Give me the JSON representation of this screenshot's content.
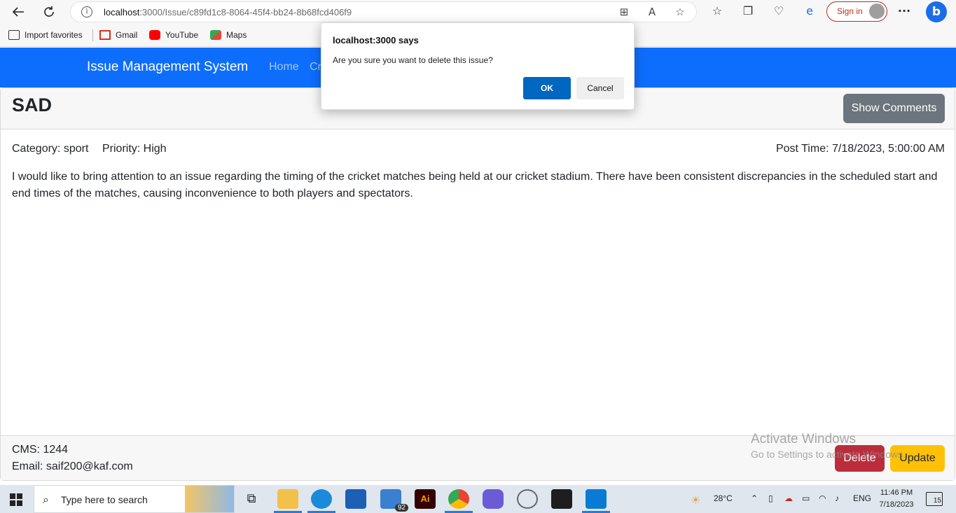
{
  "browser": {
    "url_host": "localhost",
    "url_rest": ":3000/Issue/c89fd1c8-8064-45f4-bb24-8b68fcd406f9",
    "signin_label": "Sign in",
    "bookmarks": [
      "Import favorites",
      "Gmail",
      "YouTube",
      "Maps"
    ]
  },
  "navbar": {
    "brand": "Issue Management System",
    "links": [
      "Home",
      "Cr"
    ]
  },
  "issue": {
    "title": "SAD",
    "show_comments_label": "Show Comments",
    "category": "Category: sport",
    "priority": "Priority: High",
    "post_time": "Post Time: 7/18/2023, 5:00:00 AM",
    "description": "I would like to bring attention to an issue regarding the timing of the cricket matches being held at our cricket stadium. There have been consistent discrepancies in the scheduled start and end times of the matches, causing inconvenience to both players and spectators.",
    "cms": "CMS: 1244",
    "email": "Email: saif200@kaf.com",
    "delete_label": "Delete",
    "update_label": "Update"
  },
  "watermark": {
    "line1": "Activate Windows",
    "line2": "Go to Settings to activate Windows."
  },
  "dialog": {
    "title": "localhost:3000 says",
    "message": "Are you sure you want to delete this issue?",
    "ok_label": "OK",
    "cancel_label": "Cancel"
  },
  "taskbar": {
    "search_placeholder": "Type here to search",
    "mail_badge": "92",
    "temperature": "28°C",
    "language": "ENG",
    "time": "11:46 PM",
    "date": "7/18/2023",
    "notification_count": "15"
  },
  "colors": {
    "primary": "#0d6efd",
    "danger": "#bb2d3b",
    "warning": "#ffc107",
    "secondary": "#6c757d"
  }
}
